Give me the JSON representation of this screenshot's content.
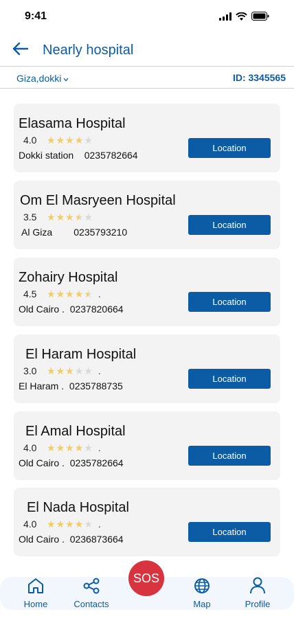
{
  "status_bar": {
    "time": "9:41"
  },
  "header": {
    "title": "Nearly hospital"
  },
  "filter": {
    "location": "Giza,dokki",
    "user_id": "ID: 3345565"
  },
  "hospitals": [
    {
      "name": "Elasama Hospital",
      "rating": "4.0",
      "area": "Dokki station",
      "phone": "0235782664",
      "stars": 4.0,
      "button": "Location"
    },
    {
      "name": "Om El Masryeen Hospital",
      "rating": "3.5",
      "area": "Al Giza",
      "phone": "0235793210",
      "stars": 3.5,
      "button": "Location"
    },
    {
      "name": "Zohairy Hospital",
      "rating": "4.5",
      "area": "Old Cairo .",
      "phone": "0237820664",
      "stars": 4.5,
      "button": "Location"
    },
    {
      "name": "El Haram Hospital",
      "rating": "3.0",
      "area": "El Haram  .",
      "phone": "0235788735",
      "stars": 3.0,
      "button": "Location"
    },
    {
      "name": "El Amal Hospital",
      "rating": "4.0",
      "area": "Old Cairo .",
      "phone": "0235782664",
      "stars": 4.0,
      "button": "Location"
    },
    {
      "name": "El Nada Hospital",
      "rating": "4.0",
      "area": "Old Cairo .",
      "phone": "0236873664",
      "stars": 4.0,
      "button": "Location"
    }
  ],
  "tabbar": {
    "home": "Home",
    "contacts": "Contacts",
    "sos": "SOS",
    "map": "Map",
    "profile": "Profile"
  },
  "colors": {
    "accent": "#0c5ca5",
    "sos": "#d8343f",
    "star": "#f2cc64",
    "card": "#f3f3f3"
  }
}
